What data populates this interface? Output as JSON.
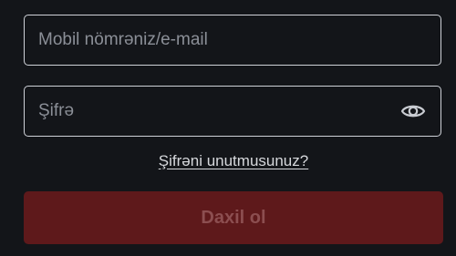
{
  "login": {
    "email": {
      "placeholder": "Mobil nömrəniz/e-mail",
      "value": ""
    },
    "password": {
      "placeholder": "Şifrə",
      "value": "",
      "toggle_icon": "eye-icon"
    },
    "forgot_password_label": "Şifrəni unutmusunuz?",
    "submit_label": "Daxil ol",
    "submit_state": "disabled"
  },
  "colors": {
    "background": "#131519",
    "field_border": "#cfd2d8",
    "placeholder": "#8b8f97",
    "button_disabled_bg": "#5e191b",
    "button_disabled_text": "#8c4e50"
  }
}
